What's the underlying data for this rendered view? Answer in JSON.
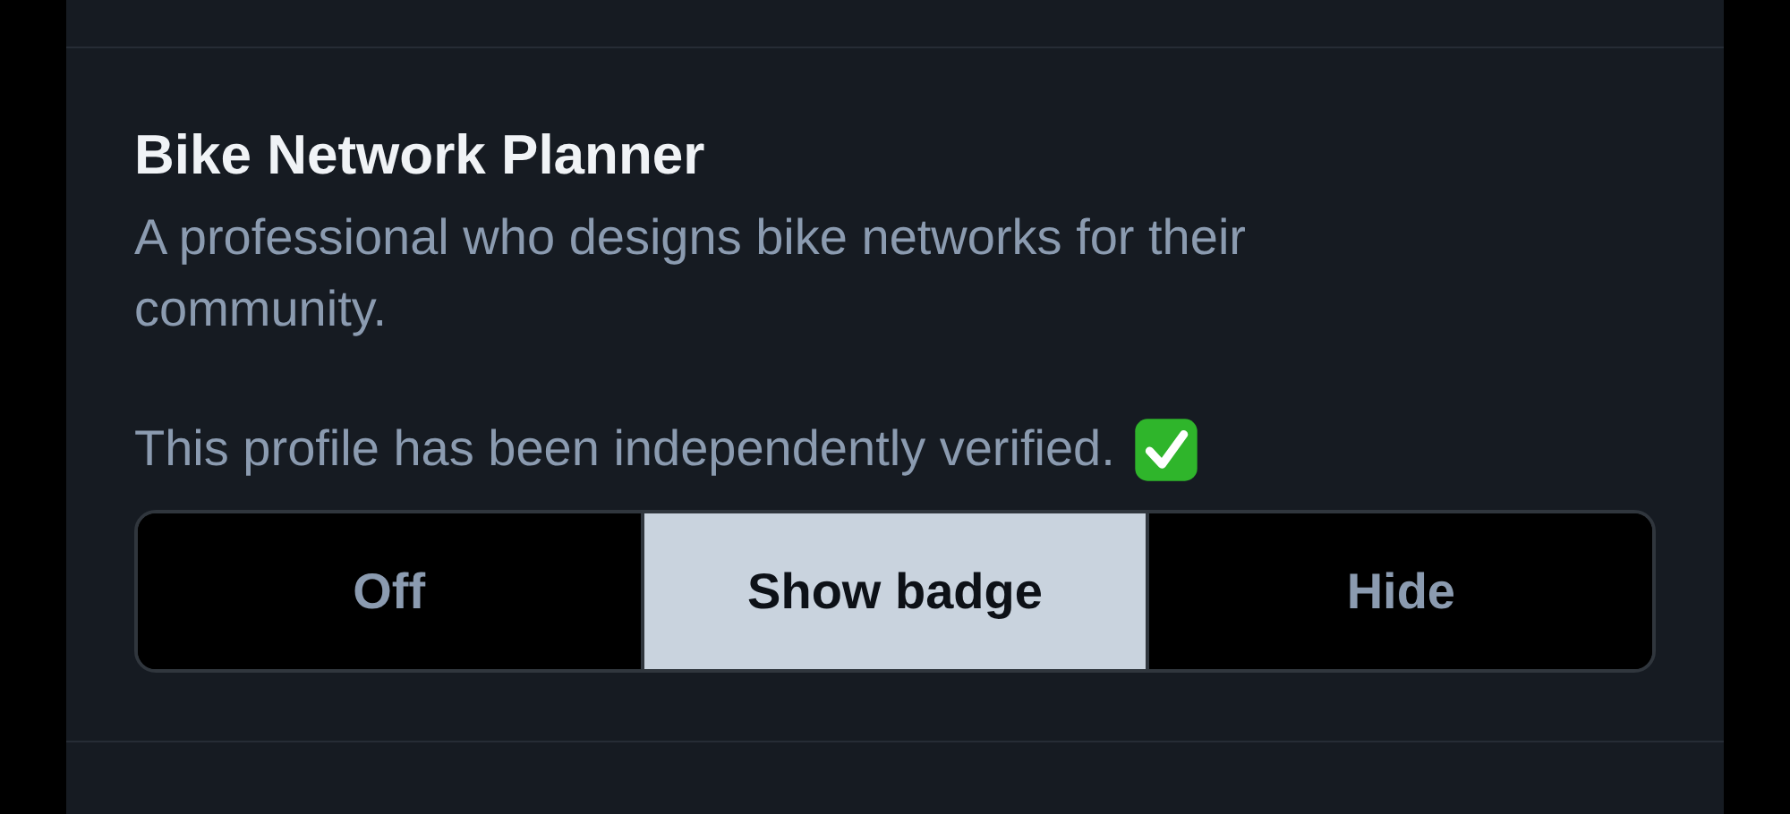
{
  "setting": {
    "title": "Bike Network Planner",
    "description": "A professional who designs bike networks for their community.",
    "note": "This profile has been independently verified.",
    "verified": true,
    "options": [
      {
        "label": "Off",
        "selected": false
      },
      {
        "label": "Show badge",
        "selected": true
      },
      {
        "label": "Hide",
        "selected": false
      }
    ]
  }
}
